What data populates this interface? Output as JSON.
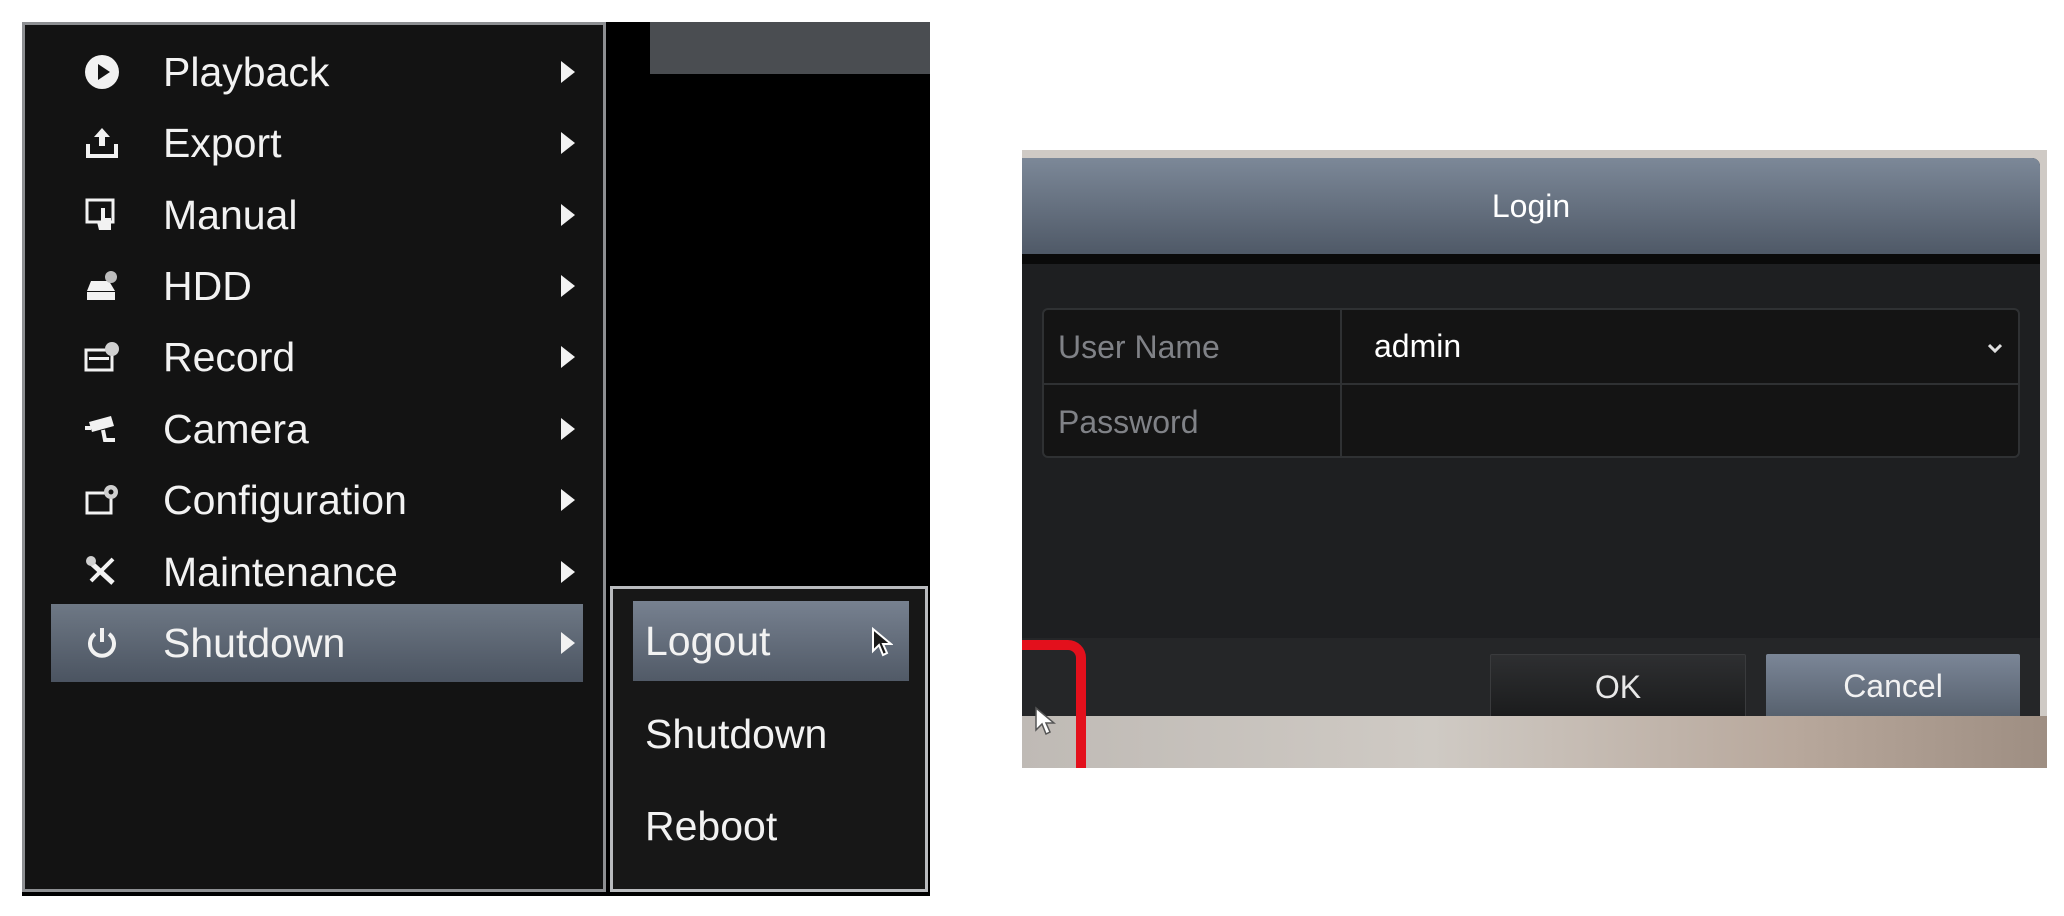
{
  "main_menu": {
    "items": [
      {
        "label": "Playback",
        "icon": "play-icon",
        "selected": false
      },
      {
        "label": "Export",
        "icon": "export-icon",
        "selected": false
      },
      {
        "label": "Manual",
        "icon": "manual-icon",
        "selected": false
      },
      {
        "label": "HDD",
        "icon": "hdd-icon",
        "selected": false
      },
      {
        "label": "Record",
        "icon": "record-icon",
        "selected": false
      },
      {
        "label": "Camera",
        "icon": "camera-icon",
        "selected": false
      },
      {
        "label": "Configuration",
        "icon": "configuration-icon",
        "selected": false
      },
      {
        "label": "Maintenance",
        "icon": "maintenance-icon",
        "selected": false
      },
      {
        "label": "Shutdown",
        "icon": "power-icon",
        "selected": true
      }
    ]
  },
  "shutdown_submenu": {
    "items": [
      {
        "label": "Logout",
        "selected": true
      },
      {
        "label": "Shutdown",
        "selected": false
      },
      {
        "label": "Reboot",
        "selected": false
      }
    ]
  },
  "login_dialog": {
    "title": "Login",
    "user_name_label": "User Name",
    "user_name_value": "admin",
    "password_label": "Password",
    "password_value": "",
    "ok_label": "OK",
    "cancel_label": "Cancel"
  },
  "colors": {
    "menu_background": "#131313",
    "selection_highlight": "#5f6976",
    "dialog_header": "#66717f",
    "annotation_red": "#e3101c"
  }
}
